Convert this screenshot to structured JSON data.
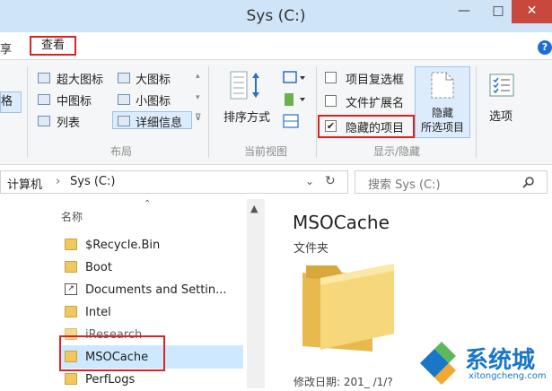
{
  "window": {
    "title": "Sys (C:)",
    "minimize_glyph": "—",
    "maximize_glyph": "□",
    "close_glyph": "✕"
  },
  "tabs": {
    "share_fragment": "享",
    "view": "查看",
    "help_glyph": "?"
  },
  "ribbon": {
    "nav_pane_fragment": "格",
    "layout": {
      "items": [
        "超大图标",
        "大图标",
        "中图标",
        "小图标",
        "列表",
        "详细信息"
      ],
      "selected": "详细信息",
      "group_label": "布局"
    },
    "current_view": {
      "sort_label": "排序方式",
      "group_label": "当前视图"
    },
    "show_hide": {
      "item_checkboxes": {
        "label": "项目复选框",
        "checked": false
      },
      "file_extensions": {
        "label": "文件扩展名",
        "checked": false
      },
      "hidden_items": {
        "label": "隐藏的项目",
        "checked": true
      },
      "hide_selected_line1": "隐藏",
      "hide_selected_line2": "所选项目",
      "group_label": "显示/隐藏"
    },
    "options_label": "选项"
  },
  "address": {
    "path": [
      "计算机",
      "Sys (C:)"
    ],
    "separator": "›",
    "search_placeholder": "搜索 Sys (C:)"
  },
  "file_list": {
    "column_header": "名称",
    "items": [
      {
        "name": "$Recycle.Bin",
        "type": "folder"
      },
      {
        "name": "Boot",
        "type": "folder"
      },
      {
        "name": "Documents and Settin...",
        "type": "shortcut"
      },
      {
        "name": "Intel",
        "type": "folder"
      },
      {
        "name": "iResearch",
        "type": "folder"
      },
      {
        "name": "MSOCache",
        "type": "folder",
        "selected": true
      },
      {
        "name": "PerfLogs",
        "type": "folder"
      }
    ]
  },
  "details": {
    "name": "MSOCache",
    "type": "文件夹",
    "modified_label": "修改日期:",
    "modified_value": "201_ /1/?"
  },
  "watermark": {
    "text": "系统城",
    "url": "xitongcheng.com"
  },
  "colors": {
    "highlight_red": "#dd2222",
    "selection_blue": "#cde8ff",
    "titlebar_blue": "#cfe4f7",
    "close_red": "#c9483d",
    "folder_yellow": "#f0c862",
    "watermark_blue": "#1a76c6"
  }
}
